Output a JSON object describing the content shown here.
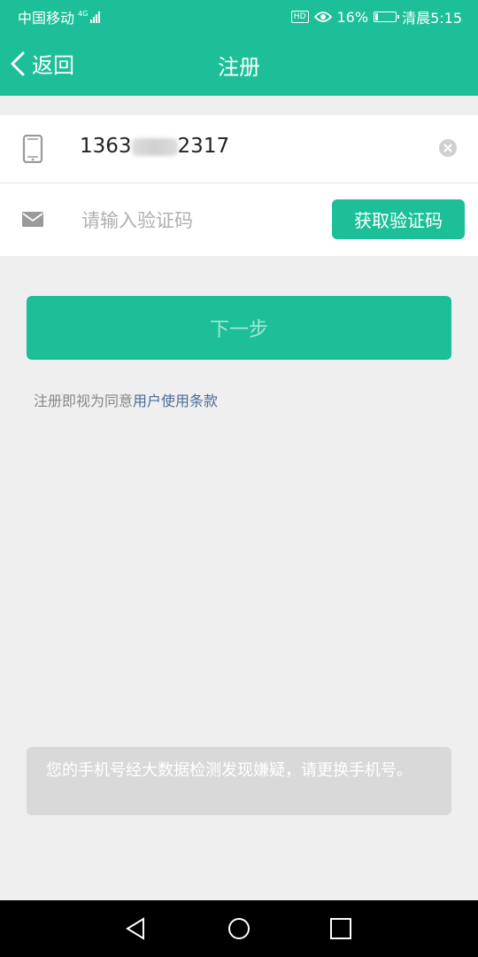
{
  "status_bar": {
    "carrier": "中国移动",
    "network": "4G",
    "hd_badge": "HD",
    "battery_percent": "16%",
    "battery_level": 0.16,
    "time": "清晨5:15"
  },
  "header": {
    "back_label": "返回",
    "title": "注册"
  },
  "form": {
    "phone_prefix": "1363",
    "phone_suffix": "2317",
    "code_placeholder": "请输入验证码",
    "code_value": "",
    "get_code_label": "获取验证码"
  },
  "actions": {
    "next_label": "下一步"
  },
  "terms": {
    "prefix": "注册即视为同意",
    "link": "用户使用条款"
  },
  "toast": {
    "message": "您的手机号经大数据检测发现嫌疑，请更换手机号。"
  },
  "colors": {
    "primary": "#1dbf98",
    "background": "#efefef",
    "link": "#4a6a99"
  },
  "icons": [
    "phone-icon",
    "mail-icon",
    "clear-icon",
    "back-chevron-icon",
    "eye-icon",
    "battery-icon",
    "signal-icon",
    "nav-back-icon",
    "nav-home-icon",
    "nav-recents-icon"
  ]
}
